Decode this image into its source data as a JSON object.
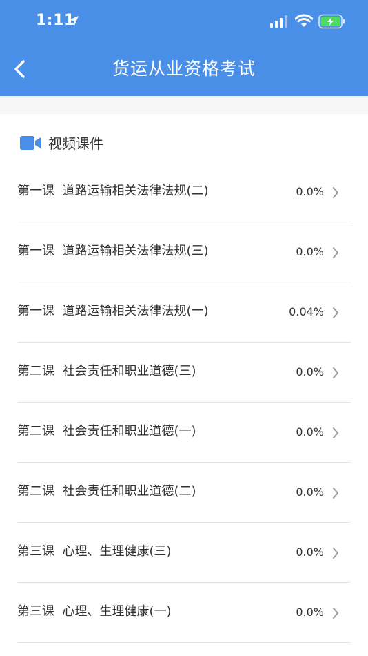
{
  "status_bar": {
    "time": "1:11"
  },
  "nav": {
    "title": "货运从业资格考试"
  },
  "section": {
    "title": "视频课件"
  },
  "lessons": [
    {
      "lesson": "第一课",
      "name": "道路运输相关法律法规(二)",
      "progress": "0.0%"
    },
    {
      "lesson": "第一课",
      "name": "道路运输相关法律法规(三)",
      "progress": "0.0%"
    },
    {
      "lesson": "第一课",
      "name": "道路运输相关法律法规(一)",
      "progress": "0.04%"
    },
    {
      "lesson": "第二课",
      "name": "社会责任和职业道德(三)",
      "progress": "0.0%"
    },
    {
      "lesson": "第二课",
      "name": "社会责任和职业道德(一)",
      "progress": "0.0%"
    },
    {
      "lesson": "第二课",
      "name": "社会责任和职业道德(二)",
      "progress": "0.0%"
    },
    {
      "lesson": "第三课",
      "name": "心理、生理健康(三)",
      "progress": "0.0%"
    },
    {
      "lesson": "第三课",
      "name": "心理、生理健康(一)",
      "progress": "0.0%"
    }
  ],
  "colors": {
    "header_bg": "#4a8fe7",
    "accent": "#4a8fe7",
    "battery_green": "#4cd964"
  },
  "icons": {
    "location": "location-arrow-icon",
    "signal": "signal-icon",
    "wifi": "wifi-icon",
    "battery": "battery-charging-icon",
    "back": "chevron-left-icon",
    "video": "video-camera-icon",
    "row_arrow": "chevron-right-icon"
  }
}
